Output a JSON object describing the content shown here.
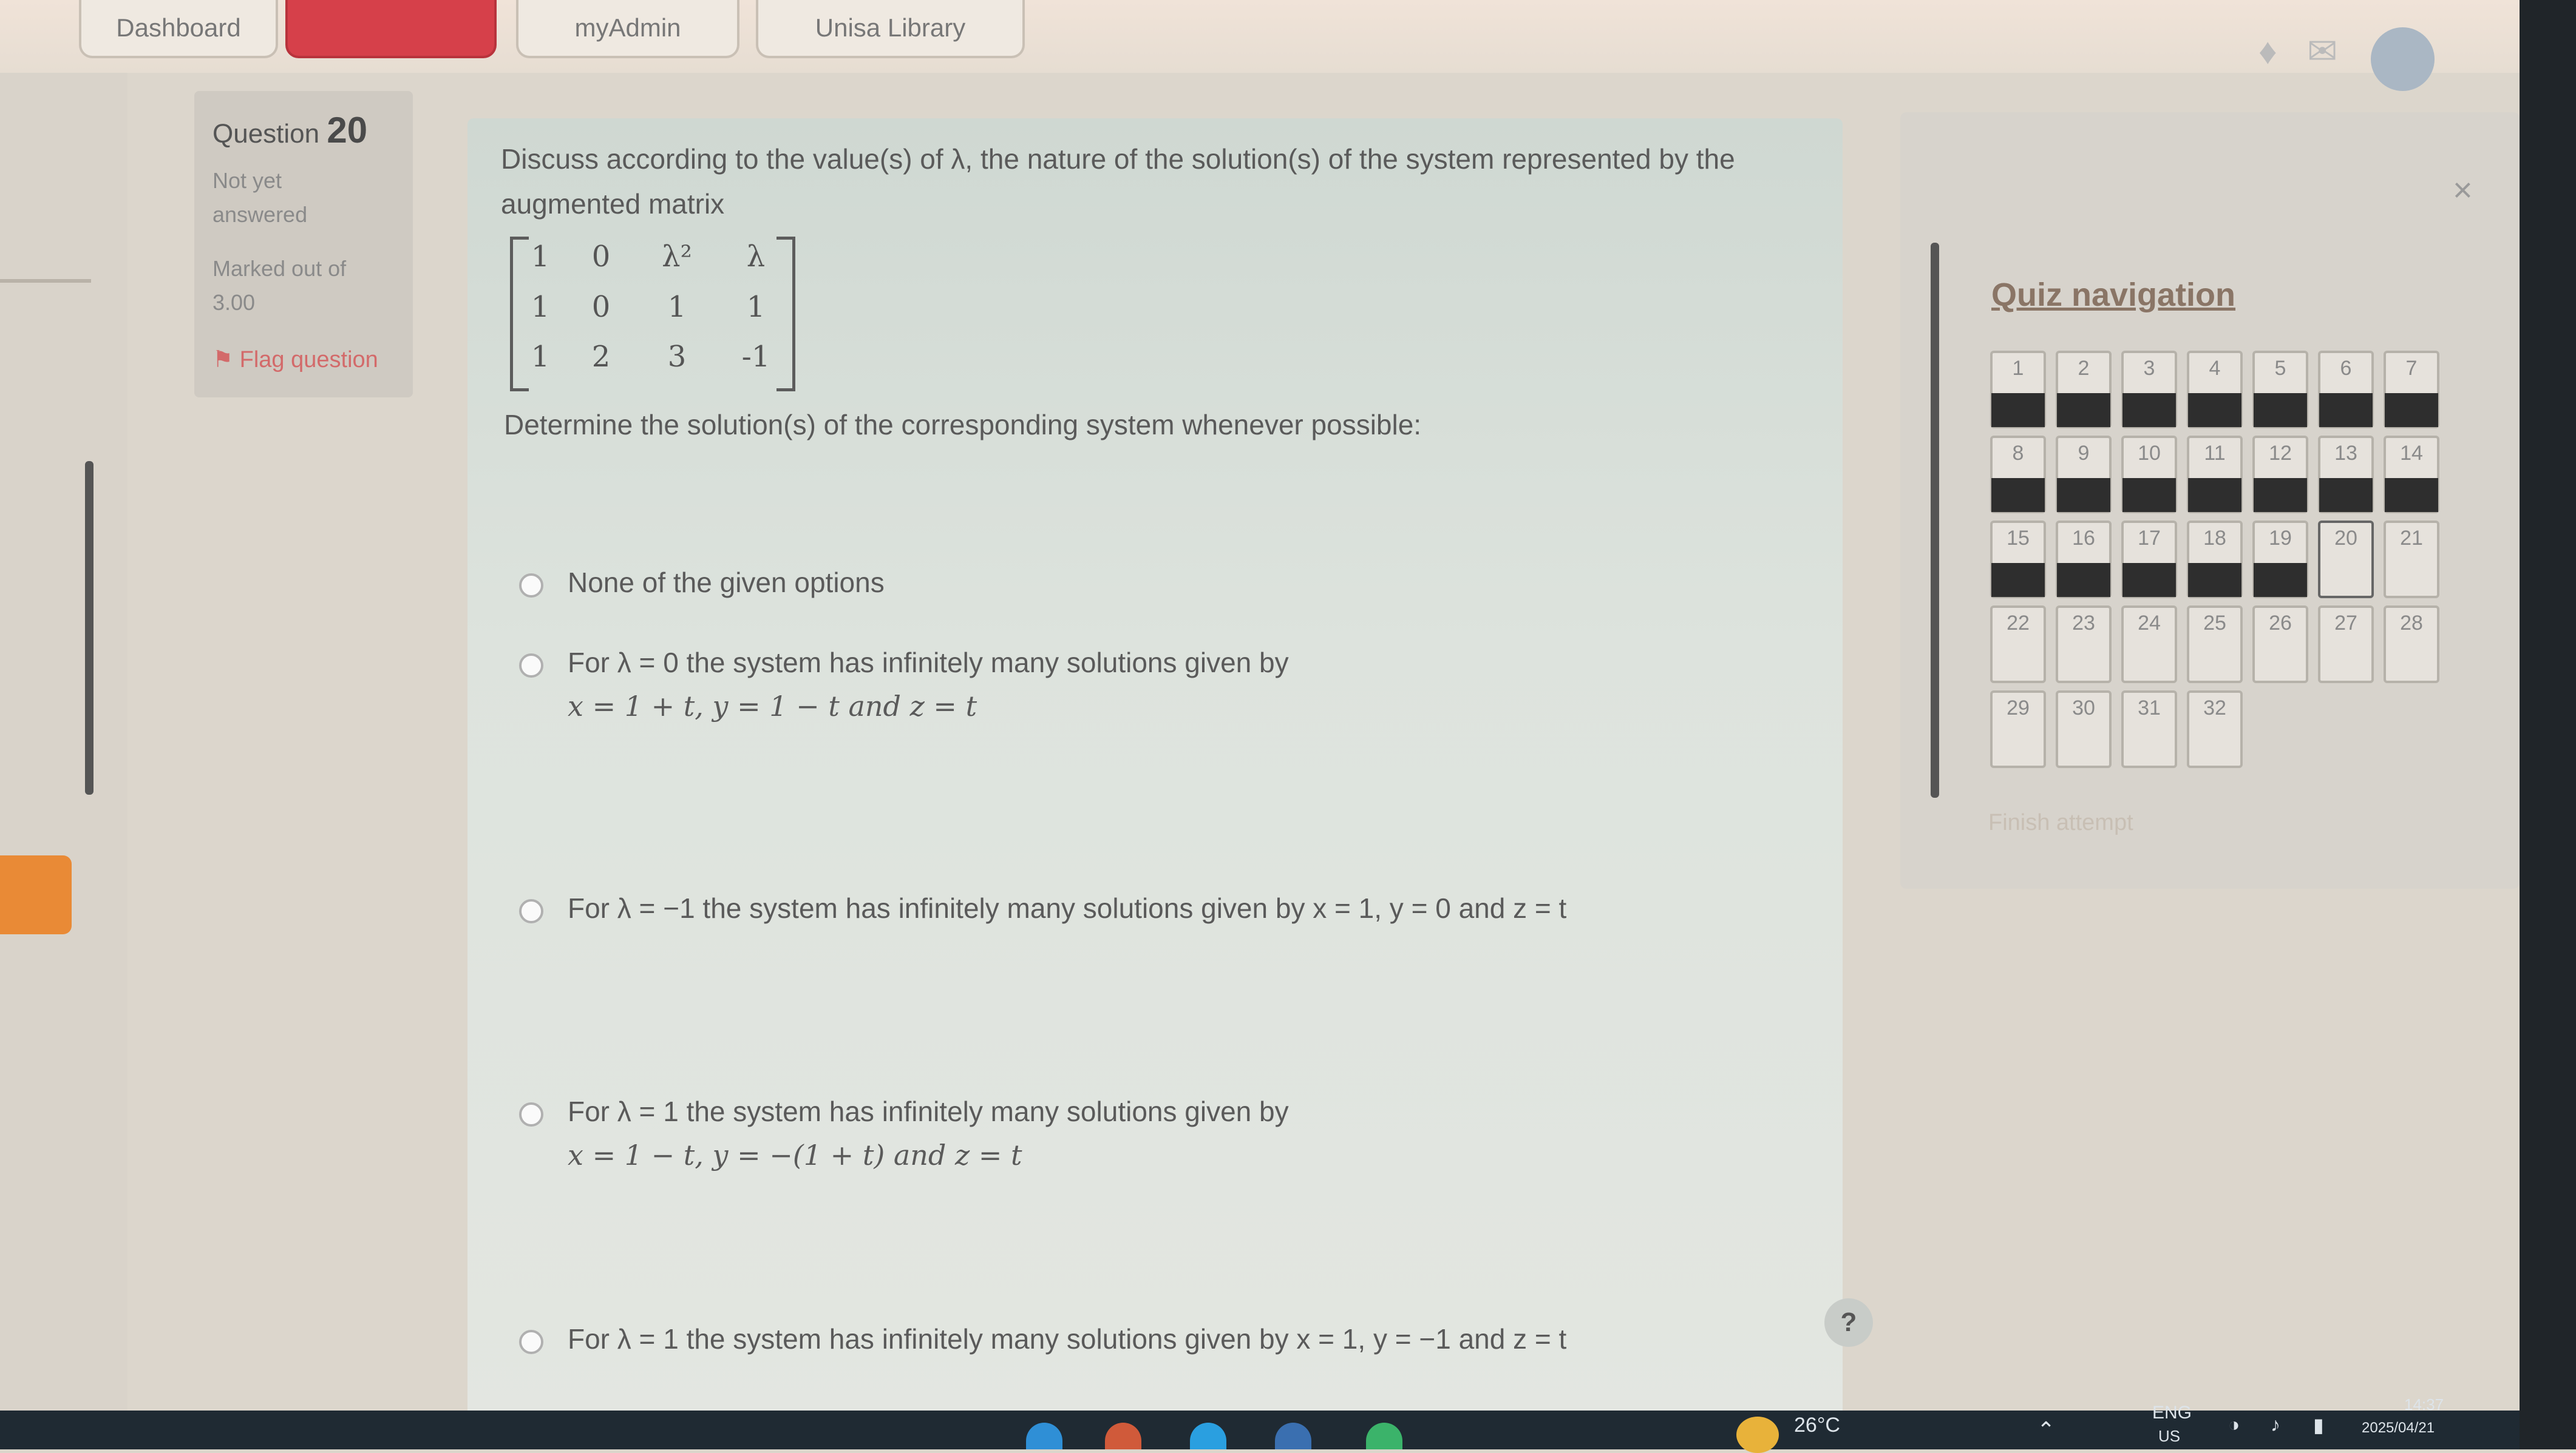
{
  "topnav": {
    "tabs": [
      {
        "label": "Dashboard",
        "active": false
      },
      {
        "label": "",
        "active": true
      },
      {
        "label": "myAdmin",
        "active": false
      },
      {
        "label": "Unisa Library",
        "active": false
      }
    ]
  },
  "question_info": {
    "prefix": "Question",
    "number": "20",
    "status": "Not yet answered",
    "marked": "Marked out of 3.00",
    "flag": "Flag question"
  },
  "question": {
    "text": "Discuss according to the value(s) of λ, the nature of the solution(s) of the system represented by the augmented matrix",
    "matrix": [
      [
        "1",
        "0",
        "λ²",
        "λ"
      ],
      [
        "1",
        "0",
        "1",
        "1"
      ],
      [
        "1",
        "2",
        "3",
        "-1"
      ]
    ],
    "determine": "Determine the solution(s) of the corresponding system whenever possible:"
  },
  "options": [
    {
      "line1": "None of the given options",
      "line2": ""
    },
    {
      "line1": "For λ = 0 the system has infinitely many solutions given by",
      "line2": "x = 1 + t,  y = 1 − t and z = t"
    },
    {
      "line1": "For λ = −1 the system has infinitely many solutions given by x = 1,  y = 0 and z = t",
      "line2": ""
    },
    {
      "line1": "For λ = 1 the system has infinitely many solutions given by",
      "line2": "x = 1 − t,  y = −(1 + t) and z = t"
    },
    {
      "line1": "For λ = 1 the system has infinitely many solutions given by x = 1,  y = −1 and z = t",
      "line2": ""
    }
  ],
  "help": "?",
  "quiz_nav": {
    "title": "Quiz navigation",
    "close": "×",
    "finish": "Finish attempt",
    "current": "20",
    "answered": [
      "1",
      "2",
      "3",
      "4",
      "5",
      "6",
      "7",
      "8",
      "9",
      "10",
      "11",
      "12",
      "13",
      "14",
      "15",
      "16",
      "17",
      "18",
      "19"
    ],
    "rows": [
      [
        "1",
        "2",
        "3",
        "4",
        "5",
        "6",
        "7"
      ],
      [
        "8",
        "9",
        "10",
        "11",
        "12",
        "13",
        "14"
      ],
      [
        "15",
        "16",
        "17",
        "18",
        "19",
        "20",
        "21"
      ],
      [
        "22",
        "23",
        "24",
        "25",
        "26",
        "27",
        "28"
      ],
      [
        "29",
        "30",
        "31",
        "32"
      ]
    ]
  },
  "taskbar": {
    "weather": "26°C",
    "lang1": "ENG",
    "lang2": "US",
    "time": "14:37",
    "date": "2025/04/21"
  },
  "colors": {
    "active_tab": "#d6404a",
    "rail_accent": "#e98a36",
    "nav_title": "#8a7566",
    "answered_fill": "#2e2e2e",
    "taskbar": "#1f2a33"
  }
}
